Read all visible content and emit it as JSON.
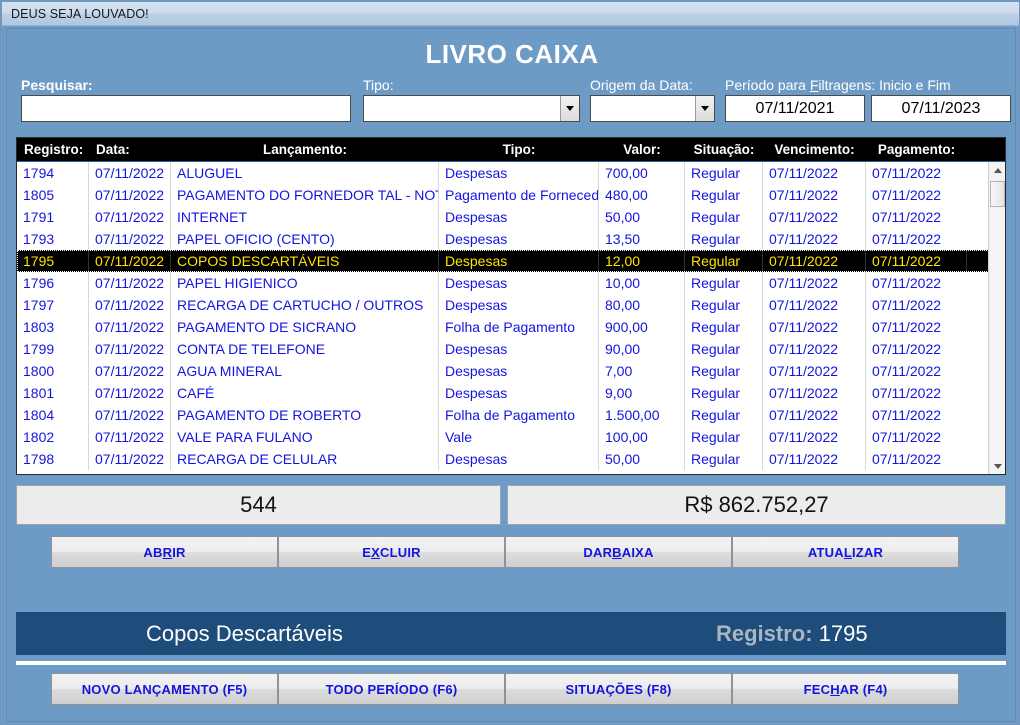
{
  "window": {
    "titlebar_text": "DEUS SEJA LOUVADO!"
  },
  "header": {
    "title": "LIVRO CAIXA"
  },
  "filters": {
    "search_label": "Pesquisar:",
    "search_value": "",
    "search_placeholder": "",
    "tipo_label": "Tipo:",
    "tipo_value": "",
    "origem_label": "Origem da Data:",
    "origem_value": "",
    "periodo_label_a": "Período para ",
    "periodo_label_accel": "F",
    "periodo_label_b": "iltragens: Inicio e Fim",
    "date_start": "07/11/2021",
    "date_end": "07/11/2023"
  },
  "grid": {
    "columns": [
      "Registro:",
      "Data:",
      "Lançamento:",
      "Tipo:",
      "Valor:",
      "Situação:",
      "Vencimento:",
      "Pagamento:"
    ],
    "rows": [
      {
        "registro": "1794",
        "data": "07/11/2022",
        "lancamento": "ALUGUEL",
        "tipo": "Despesas",
        "valor": "700,00",
        "situacao": "Regular",
        "vencimento": "07/11/2022",
        "pagamento": "07/11/2022",
        "selected": false
      },
      {
        "registro": "1805",
        "data": "07/11/2022",
        "lancamento": "PAGAMENTO DO FORNEDOR TAL - NOTA",
        "tipo": "Pagamento de Fornecedores",
        "valor": "480,00",
        "situacao": "Regular",
        "vencimento": "07/11/2022",
        "pagamento": "07/11/2022",
        "selected": false
      },
      {
        "registro": "1791",
        "data": "07/11/2022",
        "lancamento": "INTERNET",
        "tipo": "Despesas",
        "valor": "50,00",
        "situacao": "Regular",
        "vencimento": "07/11/2022",
        "pagamento": "07/11/2022",
        "selected": false
      },
      {
        "registro": "1793",
        "data": "07/11/2022",
        "lancamento": "PAPEL OFICIO (CENTO)",
        "tipo": "Despesas",
        "valor": "13,50",
        "situacao": "Regular",
        "vencimento": "07/11/2022",
        "pagamento": "07/11/2022",
        "selected": false
      },
      {
        "registro": "1795",
        "data": "07/11/2022",
        "lancamento": "COPOS DESCARTÁVEIS",
        "tipo": "Despesas",
        "valor": "12,00",
        "situacao": "Regular",
        "vencimento": "07/11/2022",
        "pagamento": "07/11/2022",
        "selected": true
      },
      {
        "registro": "1796",
        "data": "07/11/2022",
        "lancamento": "PAPEL HIGIENICO",
        "tipo": "Despesas",
        "valor": "10,00",
        "situacao": "Regular",
        "vencimento": "07/11/2022",
        "pagamento": "07/11/2022",
        "selected": false
      },
      {
        "registro": "1797",
        "data": "07/11/2022",
        "lancamento": "RECARGA DE CARTUCHO / OUTROS",
        "tipo": "Despesas",
        "valor": "80,00",
        "situacao": "Regular",
        "vencimento": "07/11/2022",
        "pagamento": "07/11/2022",
        "selected": false
      },
      {
        "registro": "1803",
        "data": "07/11/2022",
        "lancamento": "PAGAMENTO DE SICRANO",
        "tipo": "Folha de Pagamento",
        "valor": "900,00",
        "situacao": "Regular",
        "vencimento": "07/11/2022",
        "pagamento": "07/11/2022",
        "selected": false
      },
      {
        "registro": "1799",
        "data": "07/11/2022",
        "lancamento": "CONTA DE TELEFONE",
        "tipo": "Despesas",
        "valor": "90,00",
        "situacao": "Regular",
        "vencimento": "07/11/2022",
        "pagamento": "07/11/2022",
        "selected": false
      },
      {
        "registro": "1800",
        "data": "07/11/2022",
        "lancamento": "AGUA MINERAL",
        "tipo": "Despesas",
        "valor": "7,00",
        "situacao": "Regular",
        "vencimento": "07/11/2022",
        "pagamento": "07/11/2022",
        "selected": false
      },
      {
        "registro": "1801",
        "data": "07/11/2022",
        "lancamento": "CAFÉ",
        "tipo": "Despesas",
        "valor": "9,00",
        "situacao": "Regular",
        "vencimento": "07/11/2022",
        "pagamento": "07/11/2022",
        "selected": false
      },
      {
        "registro": "1804",
        "data": "07/11/2022",
        "lancamento": "PAGAMENTO DE ROBERTO",
        "tipo": "Folha de Pagamento",
        "valor": "1.500,00",
        "situacao": "Regular",
        "vencimento": "07/11/2022",
        "pagamento": "07/11/2022",
        "selected": false
      },
      {
        "registro": "1802",
        "data": "07/11/2022",
        "lancamento": "VALE PARA FULANO",
        "tipo": "Vale",
        "valor": "100,00",
        "situacao": "Regular",
        "vencimento": "07/11/2022",
        "pagamento": "07/11/2022",
        "selected": false
      },
      {
        "registro": "1798",
        "data": "07/11/2022",
        "lancamento": "RECARGA DE CELULAR",
        "tipo": "Despesas",
        "valor": "50,00",
        "situacao": "Regular",
        "vencimento": "07/11/2022",
        "pagamento": "07/11/2022",
        "selected": false
      }
    ]
  },
  "totals": {
    "count": "544",
    "amount": "R$ 862.752,27"
  },
  "actions": {
    "abrir_a": "AB",
    "abrir_accel": "R",
    "abrir_b": "IR",
    "excluir_a": "E",
    "excluir_accel": "X",
    "excluir_b": "CLUIR",
    "baixa_a": "DAR ",
    "baixa_accel": "B",
    "baixa_b": "AIXA",
    "atualizar_a": "ATUA",
    "atualizar_accel": "L",
    "atualizar_b": "IZAR"
  },
  "detail": {
    "name": "Copos Descartáveis",
    "registro_label": "Registro: ",
    "registro_value": "1795"
  },
  "footer": {
    "novo": "NOVO LANÇAMENTO (F5)",
    "periodo": "TODO PERÍODO (F6)",
    "situacoes": "SITUAÇÕES (F8)",
    "fechar_a": "FEC",
    "fechar_accel": "H",
    "fechar_b": "AR (F4)"
  },
  "colors": {
    "window_blue": "#6e9bc5",
    "band_blue": "#1e4d7b",
    "grid_text": "#1414e0",
    "selected_text": "#ffe400",
    "button_text": "#1414e0"
  }
}
